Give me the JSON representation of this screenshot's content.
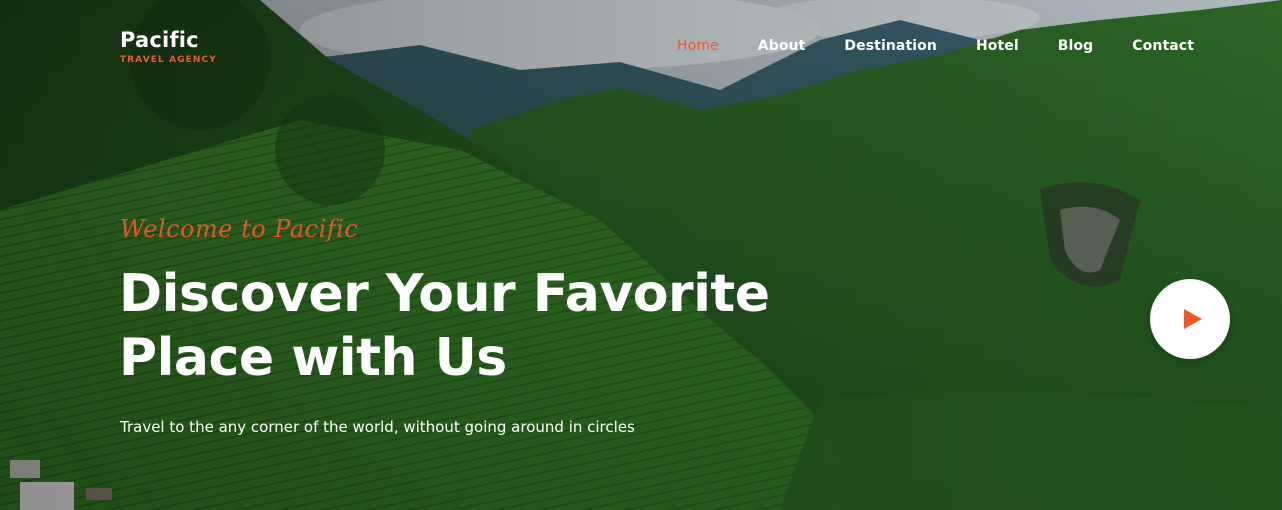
{
  "brand": {
    "name": "Pacific",
    "tagline": "TRAVEL AGENCY",
    "accent_color": "#f0592a"
  },
  "nav": {
    "items": [
      {
        "label": "Home",
        "active": true
      },
      {
        "label": "About",
        "active": false
      },
      {
        "label": "Destination",
        "active": false
      },
      {
        "label": "Hotel",
        "active": false
      },
      {
        "label": "Blog",
        "active": false
      },
      {
        "label": "Contact",
        "active": false
      }
    ]
  },
  "hero": {
    "welcome": "Welcome to Pacific",
    "headline_line1": "Discover Your Favorite",
    "headline_line2": "Place with Us",
    "subtitle": "Travel to the any corner of the world, without going around in circles",
    "play_icon": "play-icon"
  }
}
